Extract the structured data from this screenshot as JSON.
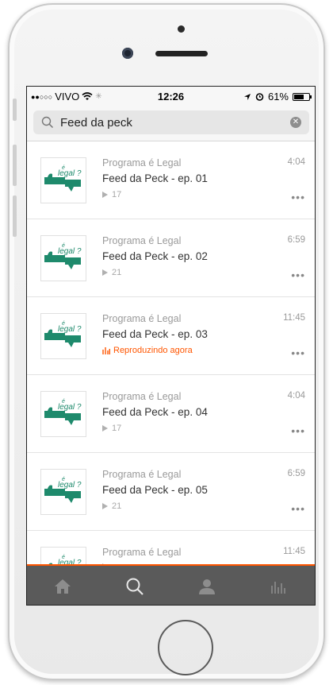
{
  "status_bar": {
    "carrier": "VIVO",
    "time": "12:26",
    "battery": "61%"
  },
  "search": {
    "query": "Feed da peck"
  },
  "tracks": [
    {
      "author": "Programa é Legal",
      "title": "Feed da Peck - ep. 01",
      "duration": "4:04",
      "plays": "17",
      "playing": false
    },
    {
      "author": "Programa é Legal",
      "title": "Feed da Peck - ep. 02",
      "duration": "6:59",
      "plays": "21",
      "playing": false
    },
    {
      "author": "Programa é Legal",
      "title": "Feed da Peck - ep. 03",
      "duration": "11:45",
      "status": "Reproduzindo agora",
      "playing": true
    },
    {
      "author": "Programa é Legal",
      "title": "Feed da Peck - ep. 04",
      "duration": "4:04",
      "plays": "17",
      "playing": false
    },
    {
      "author": "Programa é Legal",
      "title": "Feed da Peck - ep. 05",
      "duration": "6:59",
      "plays": "21",
      "playing": false
    },
    {
      "author": "Programa é Legal",
      "title": "",
      "duration": "11:45",
      "plays": "",
      "playing": false
    }
  ],
  "tab_bar": {
    "tabs": [
      "home-icon",
      "search-icon",
      "profile-icon",
      "stream-icon"
    ],
    "active": "search-icon"
  },
  "colors": {
    "accent": "#ff5500",
    "tabbar": "#5a5a5a",
    "logo_green": "#1e8a6c"
  }
}
